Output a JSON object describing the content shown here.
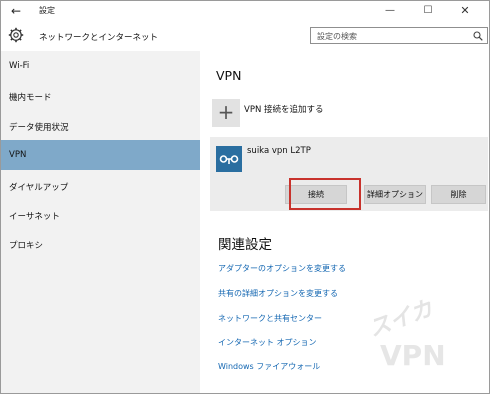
{
  "window": {
    "back_glyph": "←",
    "title": "設定",
    "min_glyph": "—",
    "max_glyph": "☐",
    "close_glyph": "✕"
  },
  "header": {
    "title": "ネットワークとインターネット",
    "search_placeholder": "設定の検索"
  },
  "sidebar": {
    "items": [
      {
        "label": "Wi-Fi"
      },
      {
        "label": "機内モード"
      },
      {
        "label": "データ使用状況"
      },
      {
        "label": "VPN",
        "active": true
      },
      {
        "label": "ダイヤルアップ"
      },
      {
        "label": "イーサネット"
      },
      {
        "label": "プロキシ"
      }
    ]
  },
  "main": {
    "heading": "VPN",
    "add_plus": "+",
    "add_label": "VPN 接続を追加する",
    "connection": {
      "name": "suika vpn L2TP",
      "connect_label": "接続",
      "advanced_label": "詳細オプション",
      "delete_label": "削除"
    },
    "related": {
      "heading": "関連設定",
      "links": [
        "アダプターのオプションを変更する",
        "共有の詳細オプションを変更する",
        "ネットワークと共有センター",
        "インターネット オプション",
        "Windows ファイアウォール"
      ]
    }
  },
  "watermark": {
    "top": "スイカ",
    "bottom": "VPN"
  },
  "colors": {
    "accent": "#7fa9c9",
    "vpn_logo": "#2a6ea0",
    "link": "#1467b2",
    "highlight": "#c8322c"
  }
}
